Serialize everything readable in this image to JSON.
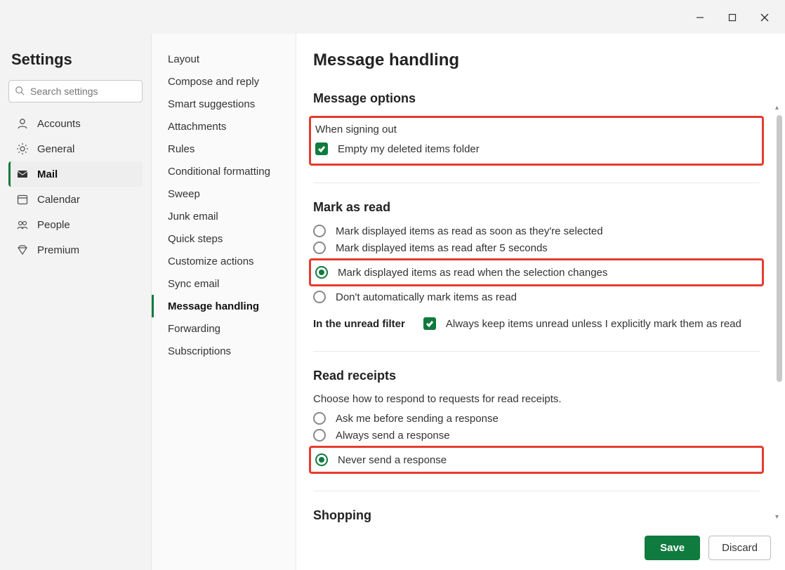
{
  "window": {
    "title": "Settings"
  },
  "sidebar1": {
    "title": "Settings",
    "search_placeholder": "Search settings",
    "items": [
      {
        "label": "Accounts",
        "icon": "person"
      },
      {
        "label": "General",
        "icon": "gear"
      },
      {
        "label": "Mail",
        "icon": "mail",
        "active": true
      },
      {
        "label": "Calendar",
        "icon": "calendar"
      },
      {
        "label": "People",
        "icon": "people"
      },
      {
        "label": "Premium",
        "icon": "diamond"
      }
    ]
  },
  "sidebar2": {
    "items": [
      "Layout",
      "Compose and reply",
      "Smart suggestions",
      "Attachments",
      "Rules",
      "Conditional formatting",
      "Sweep",
      "Junk email",
      "Quick steps",
      "Customize actions",
      "Sync email",
      "Message handling",
      "Forwarding",
      "Subscriptions"
    ],
    "active_index": 11
  },
  "main": {
    "title": "Message handling",
    "message_options": {
      "title": "Message options",
      "sublabel": "When signing out",
      "checkbox_label": "Empty my deleted items folder",
      "checkbox_checked": true
    },
    "mark_as_read": {
      "title": "Mark as read",
      "options": [
        "Mark displayed items as read as soon as they're selected",
        "Mark displayed items as read after 5 seconds",
        "Mark displayed items as read when the selection changes",
        "Don't automatically mark items as read"
      ],
      "selected_index": 2,
      "unread_filter_label": "In the unread filter",
      "unread_filter_checkbox_label": "Always keep items unread unless I explicitly mark them as read",
      "unread_filter_checked": true
    },
    "read_receipts": {
      "title": "Read receipts",
      "desc": "Choose how to respond to requests for read receipts.",
      "options": [
        "Ask me before sending a response",
        "Always send a response",
        "Never send a response"
      ],
      "selected_index": 2
    },
    "shopping": {
      "title": "Shopping"
    },
    "buttons": {
      "save": "Save",
      "discard": "Discard"
    }
  }
}
